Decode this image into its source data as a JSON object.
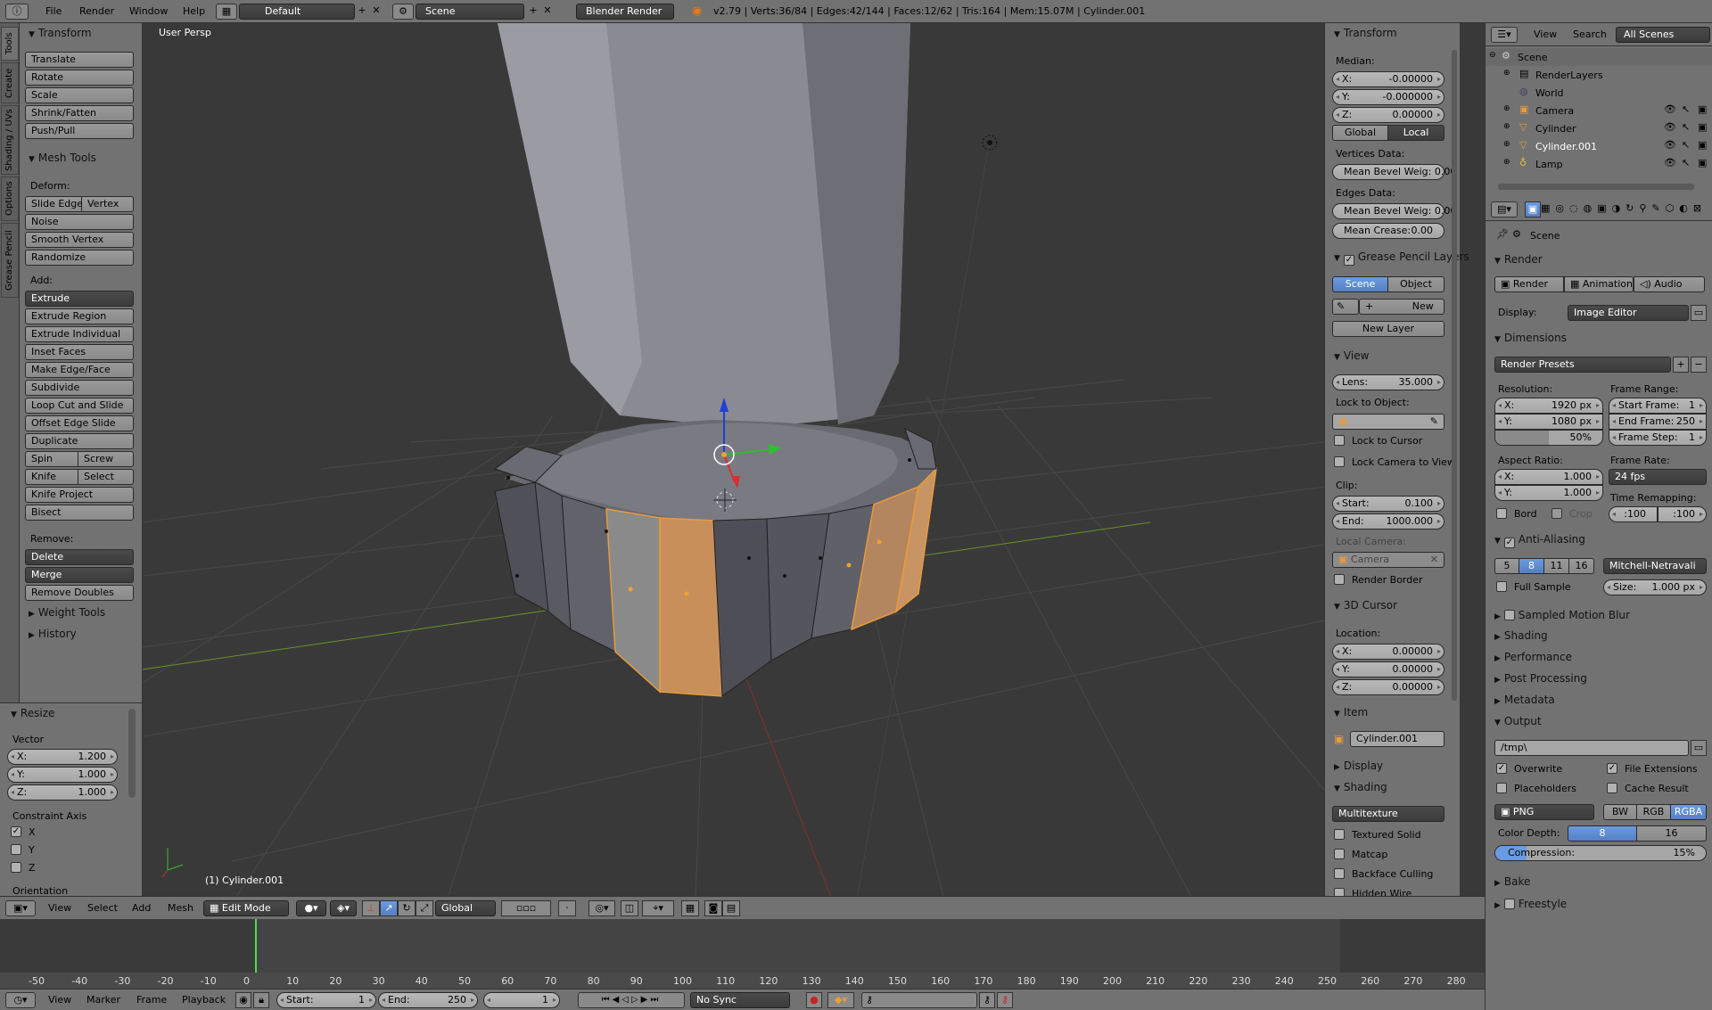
{
  "top_bar": {
    "menus": [
      "File",
      "Render",
      "Window",
      "Help"
    ],
    "layout": "Default",
    "scene": "Scene",
    "engine": "Blender Render",
    "stats": "v2.79 | Verts:36/84 | Edges:42/144 | Faces:12/62 | Tris:164 | Mem:15.07M | Cylinder.001"
  },
  "side_tabs": [
    "Tools",
    "Create",
    "Shading / UVs",
    "Options",
    "Grease Pencil"
  ],
  "tool_shelf": {
    "transform_title": "Transform",
    "transform": [
      "Translate",
      "Rotate",
      "Scale",
      "Shrink/Fatten",
      "Push/Pull"
    ],
    "mesh_tools_title": "Mesh Tools",
    "deform_label": "Deform:",
    "slide_edge": "Slide Edge",
    "vertex": "Vertex",
    "noise": "Noise",
    "smooth_vertex": "Smooth Vertex",
    "randomize": "Randomize",
    "add_label": "Add:",
    "extrude": "Extrude",
    "extrude_region": "Extrude Region",
    "extrude_individual": "Extrude Individual",
    "inset_faces": "Inset Faces",
    "make_edge_face": "Make Edge/Face",
    "subdivide": "Subdivide",
    "loop_cut": "Loop Cut and Slide",
    "offset_edge": "Offset Edge Slide",
    "duplicate": "Duplicate",
    "spin": "Spin",
    "screw": "Screw",
    "knife": "Knife",
    "select": "Select",
    "knife_project": "Knife Project",
    "bisect": "Bisect",
    "remove_label": "Remove:",
    "delete": "Delete",
    "merge": "Merge",
    "remove_doubles": "Remove Doubles",
    "weight_tools": "Weight Tools",
    "history": "History"
  },
  "operator": {
    "title": "Resize",
    "vector_label": "Vector",
    "x": "1.200",
    "y": "1.000",
    "z": "1.000",
    "constraint_label": "Constraint Axis",
    "axes": [
      "X",
      "Y",
      "Z"
    ],
    "orientation": "Orientation"
  },
  "viewport": {
    "view_name": "User Persp",
    "object_label": "(1) Cylinder.001"
  },
  "viewport_header": {
    "menus": [
      "View",
      "Select",
      "Add",
      "Mesh"
    ],
    "mode": "Edit Mode",
    "orientation": "Global"
  },
  "properties_n": {
    "transform_title": "Transform",
    "median": "Median:",
    "x": "-0.00000",
    "y": "-0.000000",
    "z": "0.00000",
    "global": "Global",
    "local": "Local",
    "vertices_data": "Vertices Data:",
    "mean_bevel_v": "Mean Bevel Weig: 0.00",
    "edges_data": "Edges Data:",
    "mean_bevel_e": "Mean Bevel Weig: 0.00",
    "mean_crease_label": "Mean Crease:",
    "mean_crease": "0.00",
    "gp_title": "Grease Pencil Layers",
    "scene": "Scene",
    "object": "Object",
    "new": "New",
    "new_layer": "New Layer",
    "view_title": "View",
    "lens_label": "Lens:",
    "lens": "35.000",
    "lock_to_object": "Lock to Object:",
    "lock_cursor": "Lock to Cursor",
    "lock_camera": "Lock Camera to View",
    "clip": "Clip:",
    "start_label": "Start:",
    "start": "0.100",
    "end_label": "End:",
    "end": "1000.000",
    "local_camera": "Local Camera:",
    "camera": "Camera",
    "render_border": "Render Border",
    "cursor_title": "3D Cursor",
    "location": "Location:",
    "cx": "0.00000",
    "cy": "0.00000",
    "cz": "0.00000",
    "item_title": "Item",
    "item_name": "Cylinder.001",
    "display_title": "Display",
    "shading_title": "Shading",
    "multitexture": "Multitexture",
    "textured_solid": "Textured Solid",
    "matcap": "Matcap",
    "backface": "Backface Culling",
    "hidden_wire": "Hidden Wire"
  },
  "outliner": {
    "menus": [
      "View",
      "Search"
    ],
    "filter": "All Scenes",
    "items": [
      "Scene",
      "RenderLayers",
      "World",
      "Camera",
      "Cylinder",
      "Cylinder.001",
      "Lamp"
    ]
  },
  "render_props": {
    "scene": "Scene",
    "render_title": "Render",
    "render_btn": "Render",
    "animation_btn": "Animation",
    "audio_btn": "Audio",
    "display_label": "Display:",
    "display_value": "Image Editor",
    "dimensions_title": "Dimensions",
    "render_presets": "Render Presets",
    "resolution": "Resolution:",
    "res_x": "1920 px",
    "res_y": "1080 px",
    "res_pct": "50%",
    "frame_range": "Frame Range:",
    "start_frame_label": "Start Frame:",
    "start_frame": "1",
    "end_frame_label": "End Frame:",
    "end_frame": "250",
    "frame_step_label": "Frame Step:",
    "frame_step": "1",
    "aspect": "Aspect Ratio:",
    "ax": "1.000",
    "ay": "1.000",
    "frame_rate": "Frame Rate:",
    "fps": "24 fps",
    "bord": "Bord",
    "crop": "Crop",
    "time_remap": "Time Remapping:",
    "remap_old": ":100",
    "remap_new": ":100",
    "aa_title": "Anti-Aliasing",
    "aa_samples": [
      "5",
      "8",
      "11",
      "16"
    ],
    "aa_filter": "Mitchell-Netravali",
    "full_sample": "Full Sample",
    "size_label": "Size:",
    "size": "1.000 px",
    "collapsed": [
      "Sampled Motion Blur",
      "Shading",
      "Performance",
      "Post Processing",
      "Metadata"
    ],
    "output_title": "Output",
    "output_path": "/tmp\\",
    "overwrite": "Overwrite",
    "file_ext": "File Extensions",
    "placeholders": "Placeholders",
    "cache_result": "Cache Result",
    "format": "PNG",
    "bw": "BW",
    "rgb": "RGB",
    "rgba": "RGBA",
    "color_depth": "Color Depth:",
    "depth8": "8",
    "depth16": "16",
    "compression": "Compression:",
    "compression_val": "15%",
    "bake": "Bake",
    "freestyle": "Freestyle"
  },
  "timeline": {
    "ticks": [
      "-50",
      "-40",
      "-30",
      "-20",
      "-10",
      "0",
      "10",
      "20",
      "30",
      "40",
      "50",
      "60",
      "70",
      "80",
      "90",
      "100",
      "110",
      "120",
      "130",
      "140",
      "150",
      "160",
      "170",
      "180",
      "190",
      "200",
      "210",
      "220",
      "230",
      "240",
      "250",
      "260",
      "270",
      "280"
    ],
    "menus": [
      "View",
      "Marker",
      "Frame",
      "Playback"
    ],
    "start_label": "Start:",
    "start": "1",
    "end_label": "End:",
    "end": "250",
    "current": "1",
    "sync": "No Sync"
  }
}
